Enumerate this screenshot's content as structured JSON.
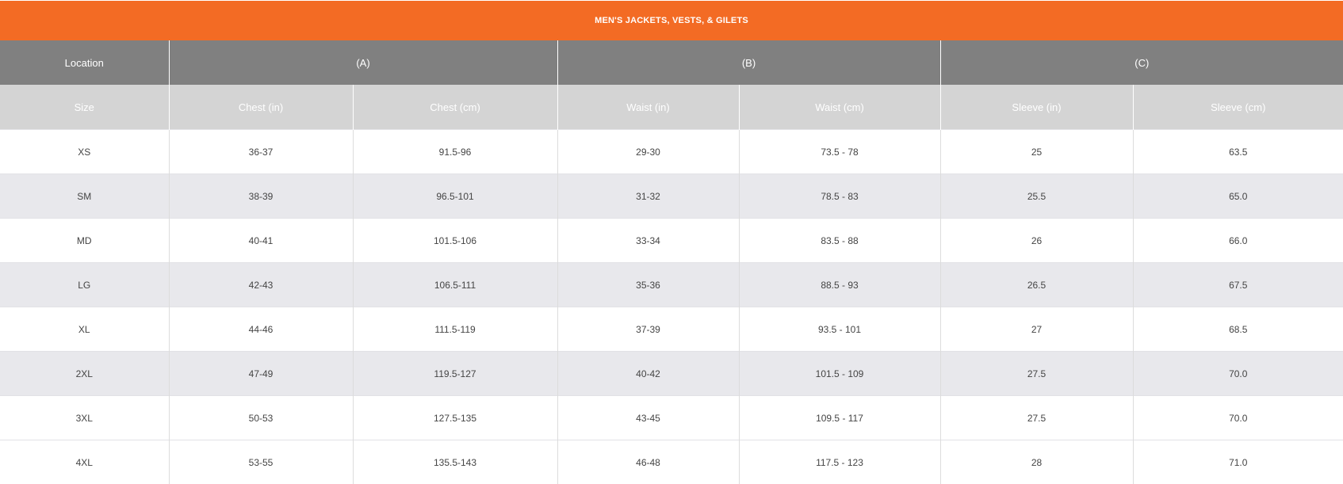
{
  "chart": {
    "title": "MEN'S JACKETS, VESTS, & GILETS",
    "header_group_label": "Location",
    "groups": [
      "(A)",
      "(B)",
      "(C)"
    ],
    "columns": [
      "Size",
      "Chest (in)",
      "Chest (cm)",
      "Waist (in)",
      "Waist (cm)",
      "Sleeve (in)",
      "Sleeve (cm)"
    ],
    "rows": [
      [
        "XS",
        "36-37",
        "91.5-96",
        "29-30",
        "73.5 - 78",
        "25",
        "63.5"
      ],
      [
        "SM",
        "38-39",
        "96.5-101",
        "31-32",
        "78.5 - 83",
        "25.5",
        "65.0"
      ],
      [
        "MD",
        "40-41",
        "101.5-106",
        "33-34",
        "83.5 - 88",
        "26",
        "66.0"
      ],
      [
        "LG",
        "42-43",
        "106.5-111",
        "35-36",
        "88.5 - 93",
        "26.5",
        "67.5"
      ],
      [
        "XL",
        "44-46",
        "111.5-119",
        "37-39",
        "93.5 - 101",
        "27",
        "68.5"
      ],
      [
        "2XL",
        "47-49",
        "119.5-127",
        "40-42",
        "101.5 - 109",
        "27.5",
        "70.0"
      ],
      [
        "3XL",
        "50-53",
        "127.5-135",
        "43-45",
        "109.5 - 117",
        "27.5",
        "70.0"
      ],
      [
        "4XL",
        "53-55",
        "135.5-143",
        "46-48",
        "117.5 - 123",
        "28",
        "71.0"
      ]
    ]
  },
  "colors": {
    "title_bg": "#f36b24",
    "group_header_bg": "#808080",
    "column_header_bg": "#d4d4d4",
    "alt_row_bg": "#e8e8ec"
  }
}
